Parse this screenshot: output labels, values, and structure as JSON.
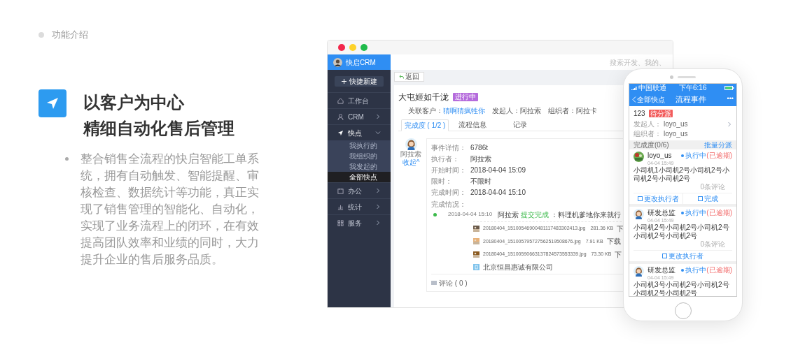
{
  "section_label": "功能介绍",
  "feature": {
    "title_lines": [
      "以客户为中心",
      "精细自动化售后管理"
    ],
    "paragraph": "整合销售全流程的快启智能工单系统，拥有自动触发、智能提醒、审核检查、数据统计等功能，真正实现了销售管理的智能化、自动化，实现了业务流程上的闭环，在有效提高团队效率和业绩的同时，大力提升企业的售后服务品质。"
  },
  "desktop": {
    "brand": "快启CRM",
    "search": {
      "placeholder": "搜索开发、我的、"
    },
    "quick_new": "快捷新建",
    "sidebar": [
      {
        "label": "工作台",
        "kind": "link",
        "expanded": false
      },
      {
        "label": "CRM",
        "kind": "group",
        "expanded": false
      },
      {
        "label": "快点",
        "kind": "group",
        "expanded": true,
        "children": [
          {
            "label": "我执行的",
            "selected": false
          },
          {
            "label": "我组织的",
            "selected": false
          },
          {
            "label": "我发起的",
            "selected": false
          },
          {
            "label": "全部快点",
            "selected": true
          }
        ]
      },
      {
        "label": "办公",
        "kind": "group",
        "expanded": false
      },
      {
        "label": "统计",
        "kind": "group",
        "expanded": false
      },
      {
        "label": "服务",
        "kind": "group",
        "expanded": false
      }
    ],
    "back": "返回",
    "task": {
      "title": "大屯姬如千泷",
      "status": "进行中",
      "meta": [
        {
          "label": "关联客户：",
          "value": "猜啊猜疯牲你",
          "link": true
        },
        {
          "label": "发起人：",
          "value": "阿拉索",
          "link": false
        },
        {
          "label": "组织者：",
          "value": "阿拉卡",
          "link": false
        }
      ],
      "tabs": [
        {
          "label": "完成度 ( 1/2 )",
          "selected": true
        },
        {
          "label": "流程信息",
          "selected": false
        },
        {
          "label": "记录",
          "selected": false
        }
      ],
      "executor": {
        "name": "阿拉索",
        "collapse": "收起^"
      },
      "details": [
        {
          "label": "事件详情：",
          "value": "6786t"
        },
        {
          "label": "执行者：",
          "value": "阿拉索"
        },
        {
          "label": "开始时间：",
          "value": "2018-04-04 15:09"
        },
        {
          "label": "限时：",
          "value": "不限时"
        },
        {
          "label": "完成时间：",
          "value": "2018-04-04 15:10"
        }
      ],
      "progress_label": "完成情况：",
      "timeline": {
        "time": "2018-04-04 15:10",
        "actor": "阿拉索",
        "action": "提交完成",
        "note": "：料理机爹地你来就行"
      },
      "files": [
        {
          "name": "20180404_15100546900481117483302413.jpg",
          "size": "281.36 KB",
          "action": "下"
        },
        {
          "name": "20180404_151005795727562519508676.jpg",
          "size": "7.91 KB",
          "action": "下载"
        },
        {
          "name": "20180404_15100590663137824573553339.jpg",
          "size": "73.30 KB",
          "action": "下"
        },
        {
          "kind": "company",
          "name": "北京恒昌惠诚有限公司"
        }
      ],
      "comments": "评论 ( 0 )"
    }
  },
  "phone": {
    "carrier": "中国联通",
    "time": "下午6:16",
    "back": "全部快点",
    "title": "流程事件",
    "more": "•••",
    "task": {
      "number": "123",
      "status": "待分派",
      "rows": [
        {
          "label": "发起人：",
          "value": "loyo_us"
        },
        {
          "label": "组织者：",
          "value": "loyo_us"
        }
      ]
    },
    "progress": {
      "label": "完成度(0/6)",
      "action": "批量分派"
    },
    "cards": [
      {
        "name": "loyo_us",
        "time": "04-04 15:49",
        "status": "执行中",
        "overdue": "(已逾期)",
        "text": "小司机1小司机2号小司机2号小司机2号小司机2号",
        "comments": "0条评论",
        "actions": [
          "更改执行者",
          "完成"
        ]
      },
      {
        "kind": "cartoon",
        "name": "研发总监",
        "time": "04-04 15:49",
        "status": "执行中",
        "overdue": "(已逾期)",
        "text": "小司机2号小司机2号小司机2号小司机2号小司机2号",
        "comments": "0条评论",
        "actions": [
          "更改执行者"
        ]
      },
      {
        "kind": "cartoon",
        "name": "研发总监",
        "time": "04-04 15:49",
        "status": "执行中",
        "overdue": "(已逾期)",
        "text": "小司机3号小司机2号小司机2号小司机2号小司机2号"
      }
    ]
  }
}
